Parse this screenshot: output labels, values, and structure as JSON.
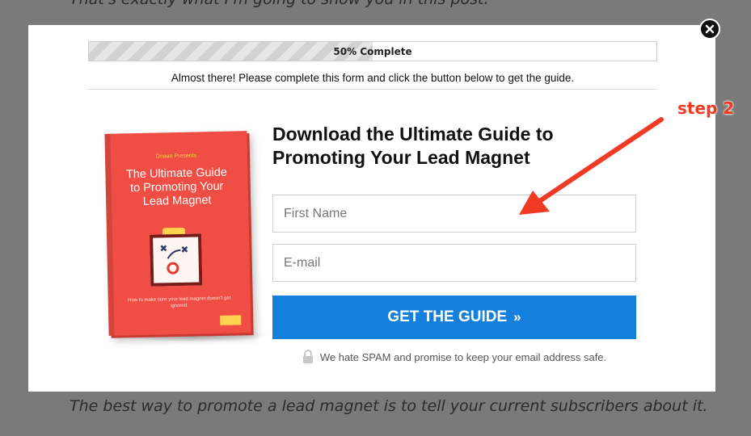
{
  "background": {
    "top_text": "That's exactly what I'm going to show you in this post.",
    "bottom_text": "The best way to promote a lead magnet is to tell your current subscribers about it."
  },
  "modal": {
    "progress": {
      "label": "50% Complete",
      "fraction": 0.5
    },
    "subtext": "Almost there! Please complete this form and click the button below to get the guide.",
    "book": {
      "brand": "Dnaan Presents",
      "title": "The Ultimate Guide to Promoting Your Lead Magnet",
      "tagline": "How to make sure your lead magnet doesn't get ignored.",
      "accent_color": "#f04e45"
    },
    "headline": "Download the Ultimate Guide to Promoting Your Lead Magnet",
    "first_name_placeholder": "First Name",
    "email_placeholder": "E-mail",
    "cta_label": "GET THE GUIDE",
    "cta_icon": "double-chevron-right-icon",
    "cta_color": "#1580dc",
    "privacy_text": "We hate SPAM and promise to keep your email address safe.",
    "privacy_icon": "lock-icon",
    "close_icon": "close-icon"
  },
  "annotation": {
    "label": "step 2",
    "color": "#f03a24"
  }
}
